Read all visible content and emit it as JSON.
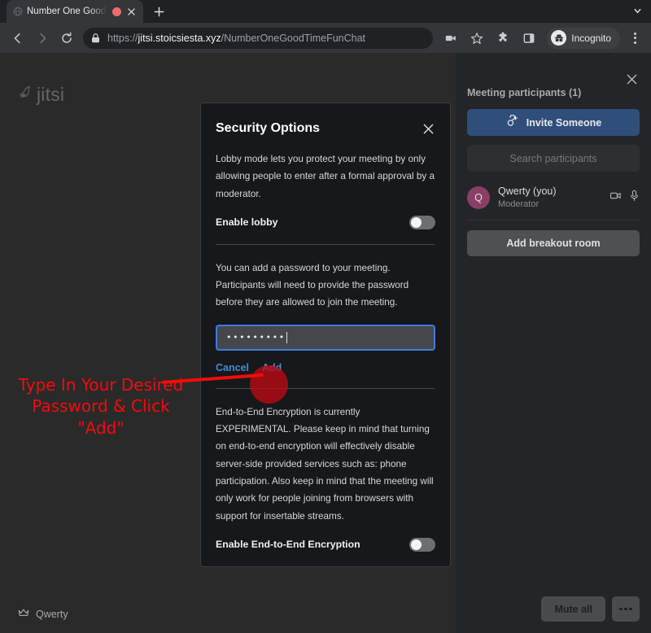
{
  "browser": {
    "tab": {
      "title": "Number One Good Time",
      "favicon_icon": "globe-icon",
      "recording_indicator_icon": "recording-dot-icon",
      "close_icon": "close-icon"
    },
    "new_tab_label": "+",
    "tab_search_icon": "chevron-down-icon",
    "nav": {
      "back_icon": "arrow-left-icon",
      "forward_icon": "arrow-right-icon",
      "reload_icon": "reload-icon"
    },
    "omnibox": {
      "lock_icon": "lock-icon",
      "scheme": "https://",
      "host": "jitsi.stoicsiesta.xyz",
      "path": "/NumberOneGoodTimeFunChat"
    },
    "actions": {
      "media_icon": "video-camera-icon",
      "bookmark_icon": "star-icon",
      "extensions_icon": "puzzle-piece-icon",
      "sidepanel_icon": "side-panel-icon",
      "incognito_icon": "incognito-icon",
      "incognito_label": "Incognito",
      "menu_icon": "three-dots-vertical-icon"
    }
  },
  "page": {
    "watermark": "jitsi",
    "watermark_icon": "jitsi-logo-icon",
    "bottom_name": "Qwerty",
    "bottom_name_icon": "crown-icon"
  },
  "participants_panel": {
    "close_icon": "close-icon",
    "title": "Meeting participants (1)",
    "invite_button": "Invite Someone",
    "invite_icon": "person-add-icon",
    "search_placeholder": "Search participants",
    "list": [
      {
        "avatar_initial": "Q",
        "name": "Qwerty (you)",
        "role": "Moderator",
        "video_icon": "video-camera-icon",
        "audio_icon": "microphone-icon"
      }
    ],
    "breakout_button": "Add breakout room",
    "mute_all_button": "Mute all",
    "more_icon": "three-dots-horizontal-icon"
  },
  "dialog": {
    "title": "Security Options",
    "close_icon": "close-icon",
    "lobby_description": "Lobby mode lets you protect your meeting by only allowing people to enter after a formal approval by a moderator.",
    "lobby_toggle_label": "Enable lobby",
    "lobby_toggle_state": "off",
    "password_description": "You can add a password to your meeting. Participants will need to provide the password before they are allowed to join the meeting.",
    "password_value": "•••••••••",
    "cancel_button": "Cancel",
    "add_button": "Add",
    "e2ee_description": "End-to-End Encryption is currently EXPERIMENTAL. Please keep in mind that turning on end-to-end encryption will effectively disable server-side provided services such as: phone participation. Also keep in mind that the meeting will only work for people joining from browsers with support for insertable streams.",
    "e2ee_toggle_label": "Enable End-to-End Encryption",
    "e2ee_toggle_state": "off"
  },
  "annotation": {
    "text": "Type In Your Desired Password & Click \"Add\"",
    "color": "#f50b0b",
    "highlight_color": "#be0a12"
  },
  "colors": {
    "page_background": "#2a2a2a",
    "panel_background": "#242528",
    "dialog_background": "#16181a",
    "invite_accent": "#2f4f7a",
    "link_accent": "#4a8ad4",
    "input_focus_border": "#3a7ee0",
    "avatar_background": "#8a3f66"
  }
}
